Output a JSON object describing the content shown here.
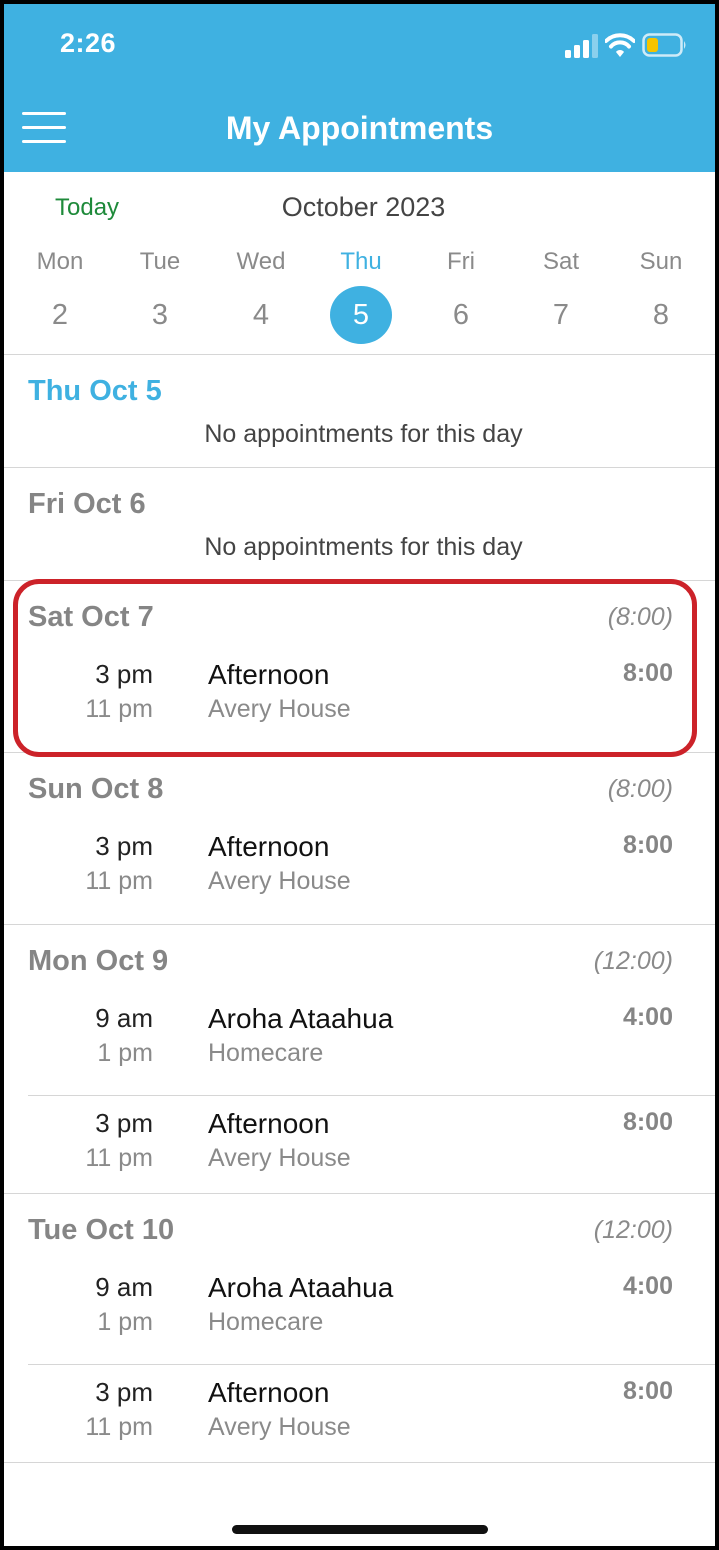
{
  "status_bar": {
    "time": "2:26"
  },
  "header": {
    "title": "My Appointments"
  },
  "calendar": {
    "today_label": "Today",
    "month": "October 2023",
    "days": [
      {
        "name": "Mon",
        "num": "2"
      },
      {
        "name": "Tue",
        "num": "3"
      },
      {
        "name": "Wed",
        "num": "4"
      },
      {
        "name": "Thu",
        "num": "5"
      },
      {
        "name": "Fri",
        "num": "6"
      },
      {
        "name": "Sat",
        "num": "7"
      },
      {
        "name": "Sun",
        "num": "8"
      }
    ],
    "selected": "5"
  },
  "schedule": {
    "empty_message": "No appointments for this day",
    "days": [
      {
        "label": "Thu Oct 5",
        "total": "",
        "appointments": []
      },
      {
        "label": "Fri Oct 6",
        "total": "",
        "appointments": []
      },
      {
        "label": "Sat Oct 7",
        "total": "(8:00)",
        "appointments": [
          {
            "start": "3 pm",
            "end": "11 pm",
            "title": "Afternoon",
            "place": "Avery House",
            "duration": "8:00"
          }
        ]
      },
      {
        "label": "Sun Oct 8",
        "total": "(8:00)",
        "appointments": [
          {
            "start": "3 pm",
            "end": "11 pm",
            "title": "Afternoon",
            "place": "Avery House",
            "duration": "8:00"
          }
        ]
      },
      {
        "label": "Mon Oct 9",
        "total": "(12:00)",
        "appointments": [
          {
            "start": "9 am",
            "end": "1 pm",
            "title": "Aroha Ataahua",
            "place": "Homecare",
            "duration": "4:00"
          },
          {
            "start": "3 pm",
            "end": "11 pm",
            "title": "Afternoon",
            "place": "Avery House",
            "duration": "8:00"
          }
        ]
      },
      {
        "label": "Tue Oct 10",
        "total": "(12:00)",
        "appointments": [
          {
            "start": "9 am",
            "end": "1 pm",
            "title": "Aroha Ataahua",
            "place": "Homecare",
            "duration": "4:00"
          },
          {
            "start": "3 pm",
            "end": "11 pm",
            "title": "Afternoon",
            "place": "Avery House",
            "duration": "8:00"
          }
        ]
      }
    ]
  },
  "colors": {
    "header": "#3fb1e1",
    "today": "#1e8a3a",
    "highlight": "#cc2229",
    "battery": "#f5c400"
  }
}
